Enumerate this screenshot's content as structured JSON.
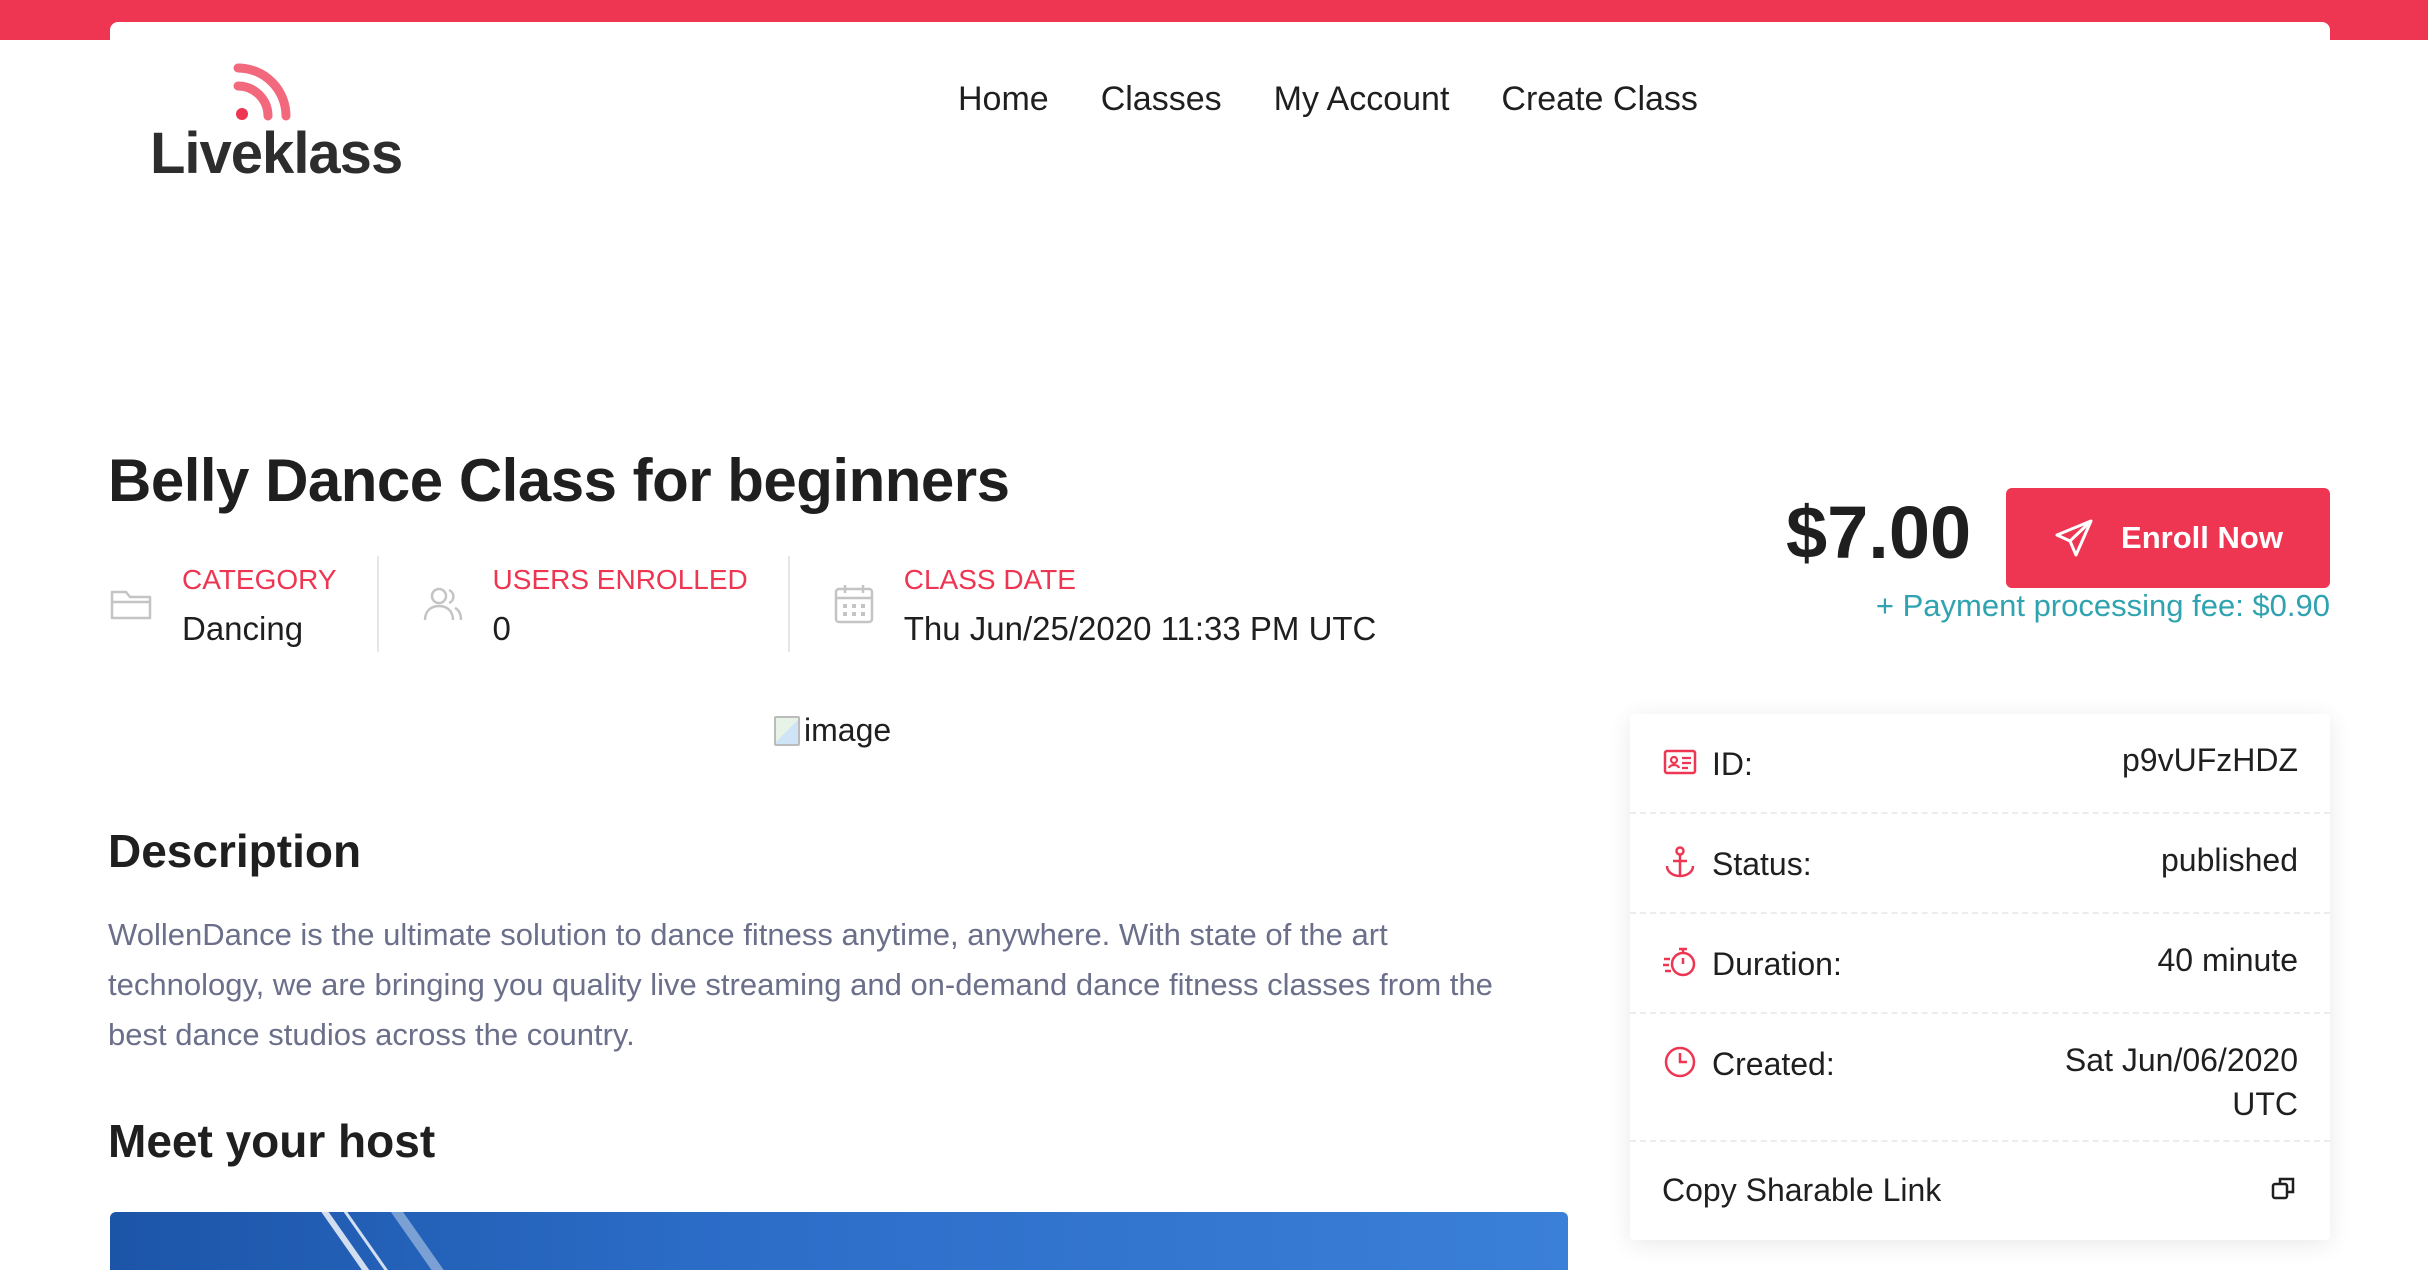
{
  "brand": {
    "name": "Liveklass",
    "accent": "#ee3552",
    "teal": "#2fa3b0"
  },
  "nav": {
    "items": [
      "Home",
      "Classes",
      "My Account",
      "Create Class"
    ]
  },
  "class": {
    "title": "Belly Dance Class for beginners",
    "meta": [
      {
        "label": "CATEGORY",
        "value": "Dancing",
        "icon": "folder-icon"
      },
      {
        "label": "USERS ENROLLED",
        "value": "0",
        "icon": "users-icon"
      },
      {
        "label": "CLASS DATE",
        "value": "Thu Jun/25/2020 11:33 PM UTC",
        "icon": "calendar-icon"
      }
    ],
    "image_alt": "image",
    "description_heading": "Description",
    "description": "WollenDance is the ultimate solution to dance fitness anytime, anywhere. With state of the art technology, we are bringing you quality live streaming and on-demand dance fitness classes from the best dance studios across the country.",
    "host_heading": "Meet your host"
  },
  "purchase": {
    "price": "$7.00",
    "enroll_label": "Enroll Now",
    "fee": "+ Payment processing fee: $0.90"
  },
  "details": {
    "rows": [
      {
        "label": "ID:",
        "value": "p9vUFzHDZ",
        "icon": "id-card-icon"
      },
      {
        "label": "Status:",
        "value": "published",
        "icon": "anchor-icon"
      },
      {
        "label": "Duration:",
        "value": "40 minute",
        "icon": "stopwatch-icon"
      },
      {
        "label": "Created:",
        "value": "Sat Jun/06/2020 UTC",
        "icon": "clock-icon"
      }
    ],
    "copy_label": "Copy Sharable Link"
  }
}
